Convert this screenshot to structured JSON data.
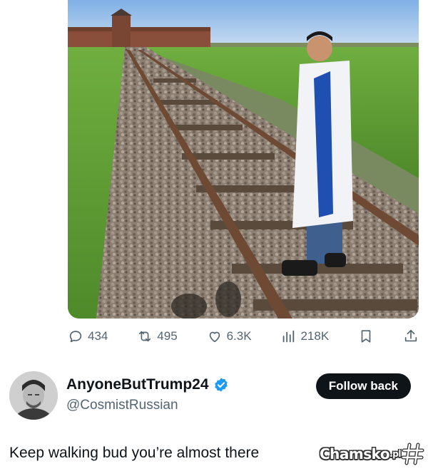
{
  "tweet": {
    "photo": {
      "subject": "person-on-railway-tracks",
      "icon": "photo-media"
    },
    "stats": {
      "replies": "434",
      "reposts": "495",
      "likes": "6.3K",
      "views": "218K"
    },
    "action_icons": [
      "reply-icon",
      "repost-icon",
      "like-icon",
      "views-icon",
      "bookmark-icon",
      "share-icon"
    ]
  },
  "profile": {
    "display_name": "AnyoneButTrump24",
    "handle": "@CosmistRussian",
    "verified": true,
    "verified_color": "#1d9bf0",
    "follow_button_label": "Follow back"
  },
  "reply": {
    "text": "Keep walking bud you’re almost there"
  },
  "watermark": {
    "text": "Chamsko",
    "suffix": ".pl"
  },
  "colors": {
    "text_primary": "#0f1419",
    "text_secondary": "#536471",
    "button_bg": "#0f1419",
    "background": "#ffffff"
  }
}
